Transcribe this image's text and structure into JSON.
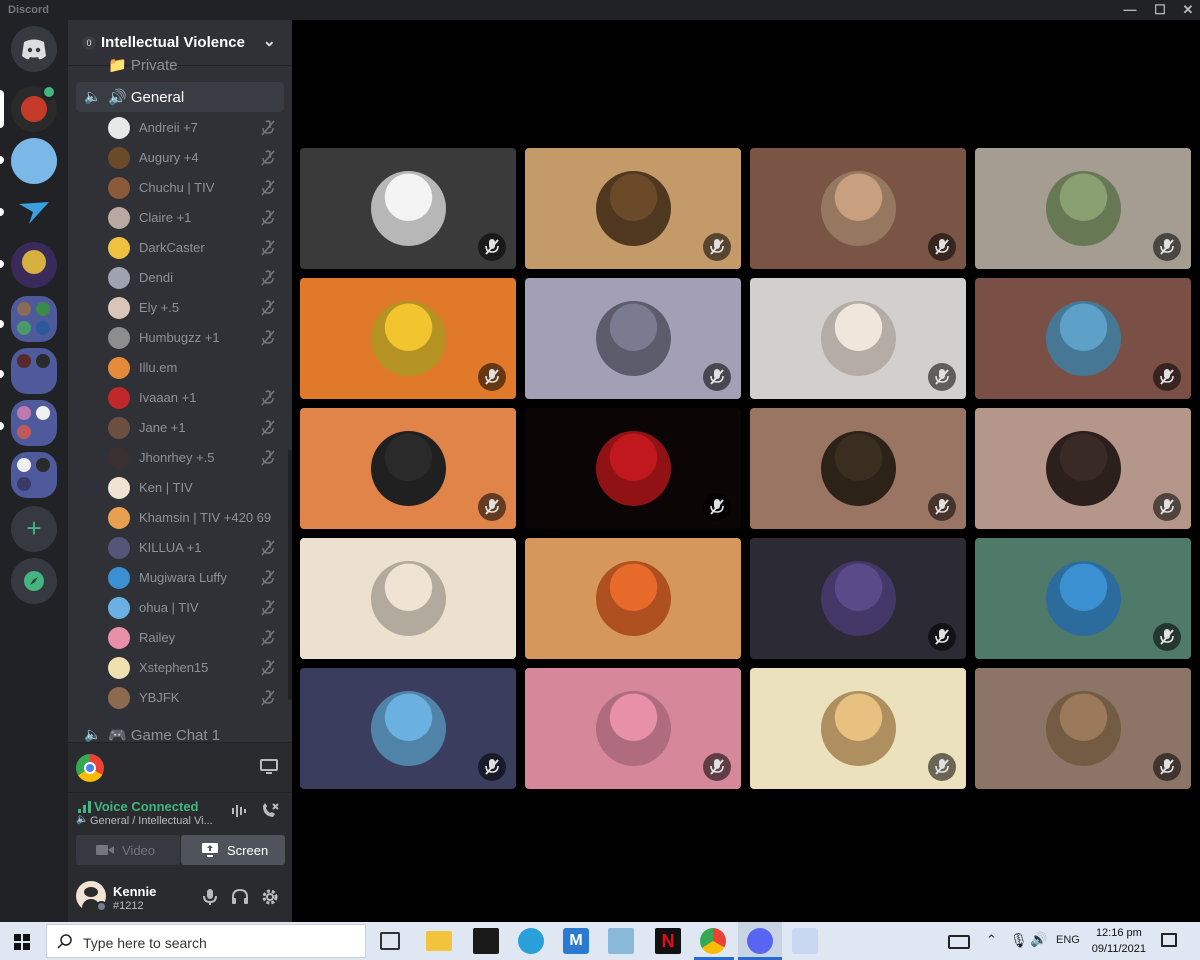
{
  "window": {
    "title": "Discord"
  },
  "server": {
    "name": "Intellectual Violence",
    "boost_count": "0"
  },
  "channels": {
    "above": "📁 Private",
    "general": "🔊 General",
    "below": "🎮 Game Chat 1"
  },
  "voice_users": [
    {
      "name": "Andreii +7",
      "muted": true,
      "color": "#e8e8e8"
    },
    {
      "name": "Augury +4",
      "muted": true,
      "color": "#6b4a2a"
    },
    {
      "name": "Chuchu | TIV",
      "muted": true,
      "color": "#8a5a3a"
    },
    {
      "name": "Claire +1",
      "muted": true,
      "color": "#b9a9a0"
    },
    {
      "name": "DarkCaster",
      "muted": true,
      "color": "#f0c040"
    },
    {
      "name": "Dendi",
      "muted": true,
      "color": "#9fa3b0"
    },
    {
      "name": "Ely +.5",
      "muted": true,
      "color": "#d9c4b8"
    },
    {
      "name": "Humbugzz +1",
      "muted": true,
      "color": "#8d8d8d"
    },
    {
      "name": "Illu.em",
      "muted": false,
      "color": "#e58a3a"
    },
    {
      "name": "Ivaaan +1",
      "muted": true,
      "color": "#c0282a"
    },
    {
      "name": "Jane +1",
      "muted": true,
      "color": "#6b5040"
    },
    {
      "name": "Jhonrhey +.5",
      "muted": true,
      "color": "#3a3030"
    },
    {
      "name": "Ken | TIV",
      "muted": false,
      "color": "#efe3d3"
    },
    {
      "name": "Khamsin | TIV +420 69",
      "muted": false,
      "color": "#e8a050"
    },
    {
      "name": "KILLUA +1",
      "muted": true,
      "color": "#55557a"
    },
    {
      "name": "Mugiwara Luffy",
      "muted": true,
      "color": "#3a90d0"
    },
    {
      "name": "ohua | TIV",
      "muted": true,
      "color": "#6ab0e0"
    },
    {
      "name": "Railey",
      "muted": true,
      "color": "#e890a8"
    },
    {
      "name": "Xstephen15",
      "muted": true,
      "color": "#f0e0b0"
    },
    {
      "name": "YBJFK",
      "muted": true,
      "color": "#8c6a50"
    }
  ],
  "voice_panel": {
    "status": "Voice Connected",
    "location": "General / Intellectual Vi...",
    "video_label": "Video",
    "screen_label": "Screen"
  },
  "user": {
    "name": "Kennie",
    "tag": "#1212"
  },
  "tiles": [
    {
      "bg": "#3a3a3a",
      "avatar": "#f4f4f4",
      "muted": true
    },
    {
      "bg": "#c49a68",
      "avatar": "#6b4a2a",
      "muted": true
    },
    {
      "bg": "#7a5546",
      "avatar": "#c8a080",
      "muted": true
    },
    {
      "bg": "#a59d92",
      "avatar": "#8aa070",
      "muted": true
    },
    {
      "bg": "#e07a2a",
      "avatar": "#f2c42e",
      "muted": true
    },
    {
      "bg": "#a3a0b5",
      "avatar": "#7a7a90",
      "muted": true
    },
    {
      "bg": "#d2d0cf",
      "avatar": "#f0e6dc",
      "muted": true
    },
    {
      "bg": "#7a4f45",
      "avatar": "#5da0c8",
      "muted": true
    },
    {
      "bg": "#e0844a",
      "avatar": "#2a2a2a",
      "muted": true
    },
    {
      "bg": "#0b0506",
      "avatar": "#c0181c",
      "muted": true
    },
    {
      "bg": "#9b7564",
      "avatar": "#3a2e20",
      "muted": true
    },
    {
      "bg": "#b4968a",
      "avatar": "#3a2a25",
      "muted": true
    },
    {
      "bg": "#ece0cf",
      "avatar": "#efe3d3",
      "muted": false
    },
    {
      "bg": "#d6985a",
      "avatar": "#e86a2a",
      "muted": false
    },
    {
      "bg": "#2c2a34",
      "avatar": "#5a4a8a",
      "muted": true
    },
    {
      "bg": "#4f7a6a",
      "avatar": "#3a90d0",
      "muted": true
    },
    {
      "bg": "#3a3d5e",
      "avatar": "#6ab0e0",
      "muted": true
    },
    {
      "bg": "#d6889a",
      "avatar": "#e890a8",
      "muted": true
    },
    {
      "bg": "#ece1bd",
      "avatar": "#e8c080",
      "muted": true
    },
    {
      "bg": "#8c7466",
      "avatar": "#9a7a5a",
      "muted": true
    }
  ],
  "taskbar": {
    "search_placeholder": "Type here to search",
    "lang": "ENG",
    "time": "12:16 pm",
    "date": "09/11/2021"
  },
  "colors": {
    "online_green": "#43b581",
    "muted_icon": "#b9bbbe"
  }
}
